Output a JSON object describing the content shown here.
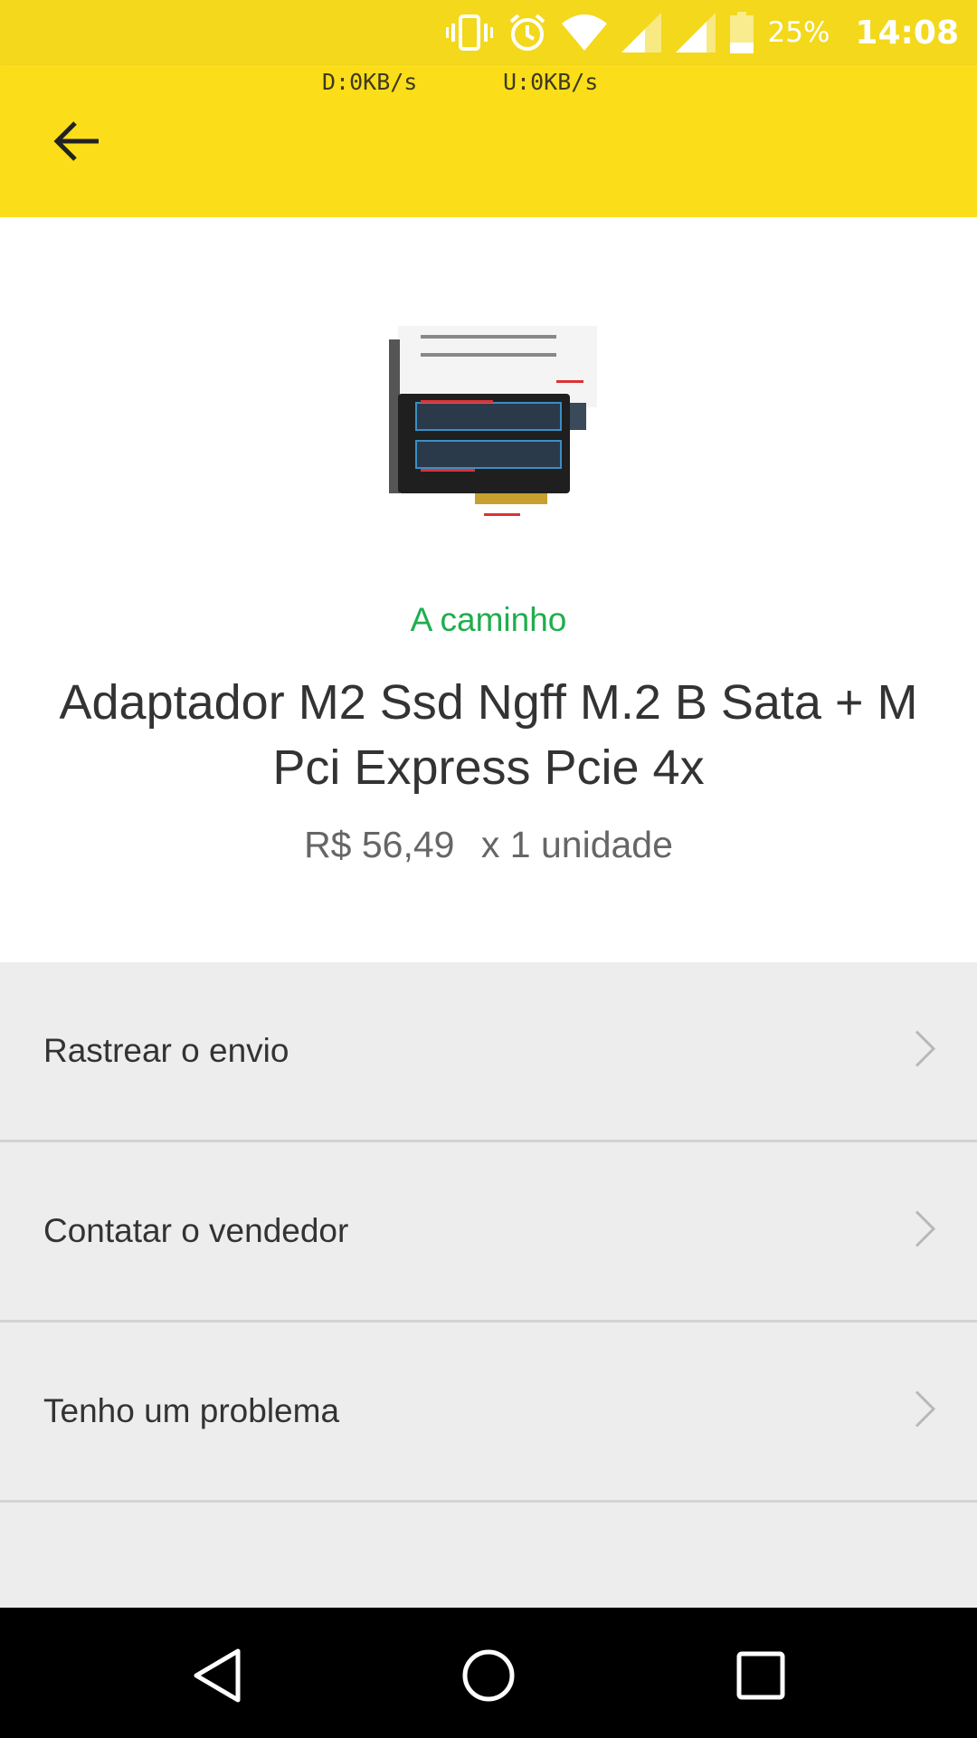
{
  "status_bar": {
    "battery_percent": "25%",
    "time": "14:08",
    "icons": [
      "vibrate-icon",
      "alarm-icon",
      "wifi-icon",
      "signal-icon",
      "signal-icon-2",
      "battery-icon"
    ],
    "net_down": "D:0KB/s",
    "net_up": "U:0KB/s"
  },
  "toolbar": {
    "back_icon": "arrow-left-icon"
  },
  "order": {
    "status": "A caminho",
    "status_color": "#1fae4d",
    "title": "Adaptador M2 Ssd Ngff M.2 B Sata + M Pci Express Pcie 4x",
    "price": "R$ 56,49",
    "quantity": "x 1 unidade"
  },
  "actions": [
    {
      "label": "Rastrear o envio"
    },
    {
      "label": "Contatar o vendedor"
    },
    {
      "label": "Tenho um problema"
    }
  ],
  "nav": {
    "back_icon": "triangle-back-icon",
    "home_icon": "circle-home-icon",
    "recents_icon": "square-recents-icon"
  },
  "colors": {
    "brand_yellow": "#fbde19",
    "statusbar_yellow": "#f3d81c"
  }
}
